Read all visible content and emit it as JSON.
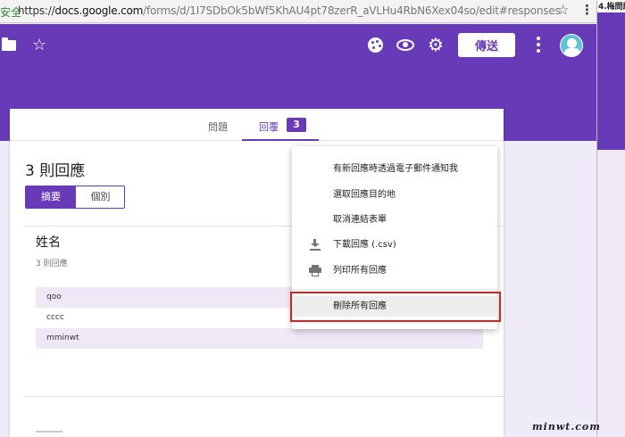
{
  "browser": {
    "secure_label": "安全",
    "url_host": "docs.google.com",
    "url_path": "/forms/d/1I7SDbOk5bWf5KhAU4pt78zerR_aVLHu4RbN6Xex04so/edit#responses",
    "url_scheme": "https://",
    "bookmark_icon": "star-outline-icon",
    "menu_icon": "vertical-dots-icon",
    "side_tab_label": "4.梅問題"
  },
  "header": {
    "send_label": "傳送",
    "accent_color": "#673ab7",
    "icons": [
      "folder-icon",
      "star-outline-icon",
      "palette-icon",
      "eye-icon",
      "gear-icon",
      "more-vert-icon",
      "avatar"
    ]
  },
  "tabs": {
    "questions_label": "問題",
    "responses_label": "回覆",
    "responses_count": "3"
  },
  "summary": {
    "title": "3 則回應",
    "segment_summary": "摘要",
    "segment_individual": "個別"
  },
  "question": {
    "title": "姓名",
    "subtitle": "3 則回應",
    "answers": [
      "qoo",
      "cccc",
      "mminwt"
    ]
  },
  "menu": {
    "items": [
      {
        "label": "有新回應時透過電子郵件通知我"
      },
      {
        "label": "選取回應目的地"
      },
      {
        "label": "取消連結表單"
      },
      {
        "label": "下載回應 (.csv)",
        "icon": "download-icon"
      },
      {
        "label": "列印所有回應",
        "icon": "print-icon"
      },
      {
        "label": "刪除所有回應"
      }
    ]
  },
  "watermark": "minwt.com"
}
